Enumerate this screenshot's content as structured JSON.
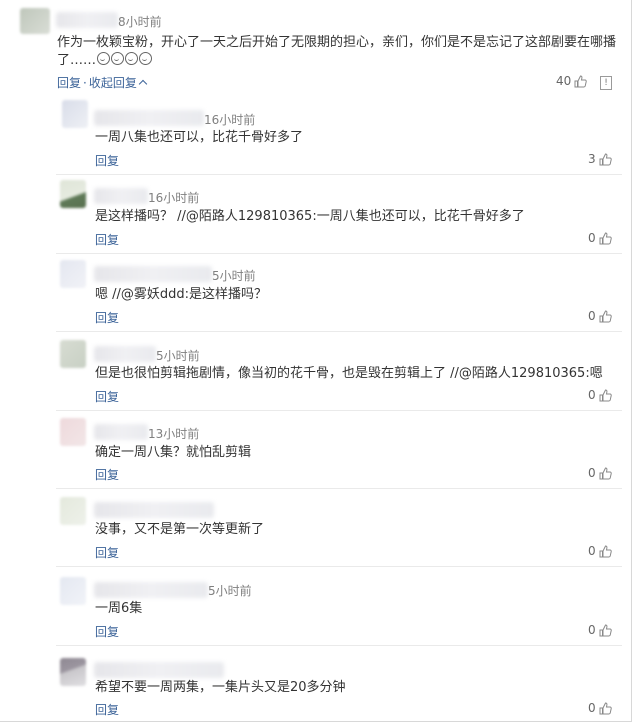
{
  "main_comment": {
    "time": "8小时前",
    "text_line1": "作为一枚颖宝粉，开心了一天之后开始了无限期的担心，亲们，你们是不是忘记了这部剧要在哪播",
    "text_line2": "了……",
    "emojis": [
      "smile",
      "smile",
      "smile",
      "smile"
    ],
    "reply_label": "回复",
    "collapse_label": "收起回复",
    "separator": "·",
    "likes": "40"
  },
  "replies": [
    {
      "time": "16小时前",
      "text": "一周八集也还可以，比花千骨好多了",
      "reply_label": "回复",
      "likes": "3"
    },
    {
      "time": "16小时前",
      "text": "是这样播吗？ //@陌路人129810365:一周八集也还可以，比花千骨好多了",
      "reply_label": "回复",
      "likes": "0"
    },
    {
      "time": "5小时前",
      "text": "嗯 //@雾妖ddd:是这样播吗？",
      "reply_label": "回复",
      "likes": "0"
    },
    {
      "time": "5小时前",
      "text": "但是也很怕剪辑拖剧情，像当初的花千骨，也是毁在剪辑上了 //@陌路人129810365:嗯",
      "reply_label": "回复",
      "likes": "0"
    },
    {
      "time": "13小时前",
      "text": "确定一周八集？就怕乱剪辑",
      "reply_label": "回复",
      "likes": "0"
    },
    {
      "time": "",
      "text": "没事，又不是第一次等更新了",
      "reply_label": "回复",
      "likes": "0"
    },
    {
      "time": "5小时前",
      "text": "一周6集",
      "reply_label": "回复",
      "likes": "0"
    },
    {
      "time": "",
      "text": "希望不要一周两集，一集片头又是20多分钟",
      "reply_label": "回复",
      "likes": "0"
    }
  ]
}
